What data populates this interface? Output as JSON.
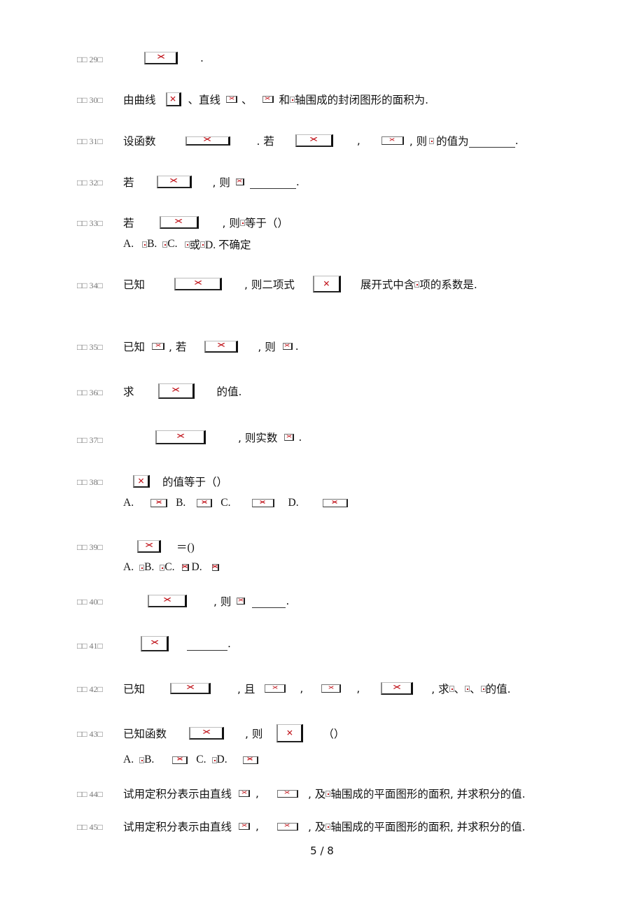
{
  "questions": [
    {
      "num": "□□ 29□",
      "parts": [
        "."
      ]
    },
    {
      "num": "□□ 30□",
      "parts": [
        "由曲线",
        "、直线",
        "、",
        "和",
        "轴围成的封闭图形的面积为."
      ]
    },
    {
      "num": "□□ 31□",
      "parts": [
        "设函数",
        ". 若",
        ",",
        ", 则",
        "的值为",
        "."
      ]
    },
    {
      "num": "□□ 32□",
      "parts": [
        "若",
        ", 则",
        "."
      ]
    },
    {
      "num": "□□ 33□",
      "parts": [
        "若",
        ", 则",
        "等于（）"
      ],
      "options": [
        "A.",
        "B.",
        "C.",
        "或",
        "D. 不确定"
      ]
    },
    {
      "num": "□□ 34□",
      "parts": [
        "已知",
        ", 则二项式",
        "展开式中含",
        "项的系数是."
      ]
    },
    {
      "num": "□□ 35□",
      "parts": [
        "已知",
        ", 若",
        ", 则",
        "."
      ]
    },
    {
      "num": "□□ 36□",
      "parts": [
        "求",
        "的值."
      ]
    },
    {
      "num": "□□ 37□",
      "parts": [
        ", 则实数",
        "."
      ]
    },
    {
      "num": "□□ 38□",
      "parts": [
        "的值等于（）"
      ],
      "options": [
        "A.",
        "B.",
        "C.",
        "D."
      ]
    },
    {
      "num": "□□ 39□",
      "parts": [
        "＝()"
      ],
      "options": [
        "A.",
        "B.",
        "C.",
        "D."
      ]
    },
    {
      "num": "□□ 40□",
      "parts": [
        ", 则",
        "."
      ]
    },
    {
      "num": "□□ 41□",
      "parts": [
        "."
      ]
    },
    {
      "num": "□□ 42□",
      "parts": [
        "已知",
        ", 且",
        ",",
        ",",
        ", 求",
        "、",
        "、",
        "的值."
      ]
    },
    {
      "num": "□□ 43□",
      "parts": [
        "已知函数",
        ", 则",
        "（）"
      ],
      "options": [
        "A.",
        "B.",
        "C.",
        "D."
      ]
    },
    {
      "num": "□□ 44□",
      "parts": [
        "试用定积分表示由直线",
        ",",
        ", 及",
        "轴围成的平面图形的面积, 并求积分的值."
      ]
    },
    {
      "num": "□□ 45□",
      "parts": [
        "试用定积分表示由直线",
        ",",
        ", 及",
        "轴围成的平面图形的面积, 并求积分的值."
      ]
    }
  ],
  "footer": {
    "page_indicator": "5 / 8"
  }
}
